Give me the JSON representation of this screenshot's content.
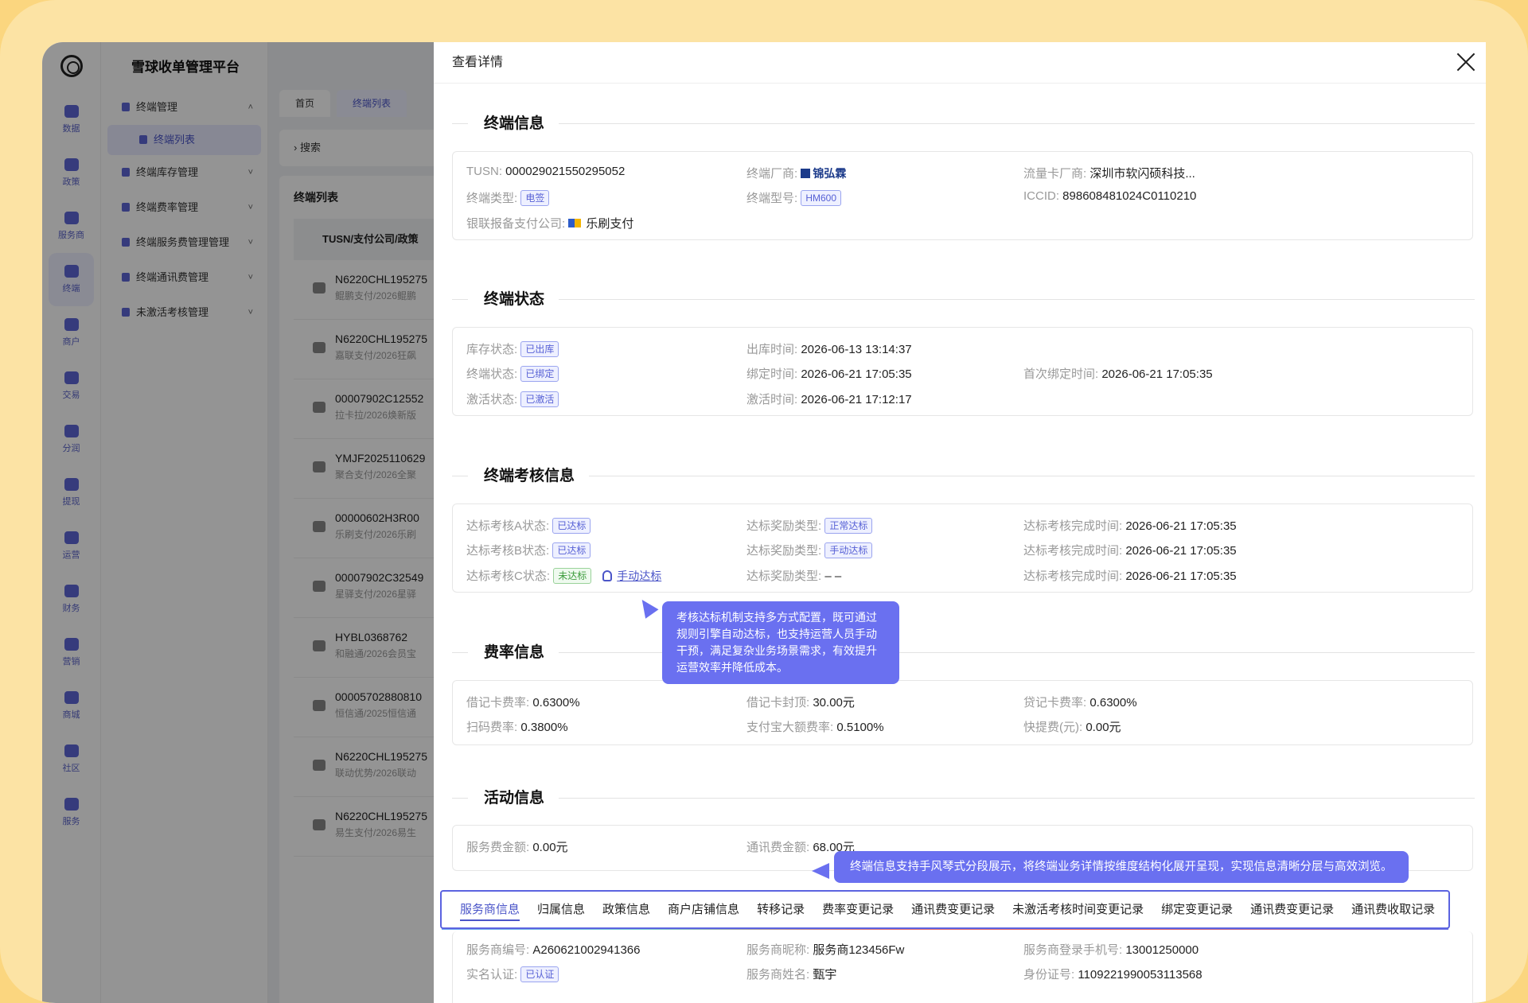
{
  "platform_name": "雪球收单管理平台",
  "rail": [
    {
      "label": "数据",
      "icon": "chart-icon"
    },
    {
      "label": "政策",
      "icon": "grid-icon"
    },
    {
      "label": "服务商",
      "icon": "user-icon"
    },
    {
      "label": "终端",
      "icon": "terminal-icon"
    },
    {
      "label": "商户",
      "icon": "shop-icon"
    },
    {
      "label": "交易",
      "icon": "trade-icon"
    },
    {
      "label": "分润",
      "icon": "split-icon"
    },
    {
      "label": "提现",
      "icon": "withdraw-icon"
    },
    {
      "label": "运营",
      "icon": "monitor-icon"
    },
    {
      "label": "财务",
      "icon": "shield-icon"
    },
    {
      "label": "营销",
      "icon": "gift-icon"
    },
    {
      "label": "商城",
      "icon": "bag-icon"
    },
    {
      "label": "社区",
      "icon": "chat-icon"
    },
    {
      "label": "服务",
      "icon": "service-icon"
    }
  ],
  "menu": {
    "items": [
      {
        "label": "终端管理",
        "chev": "˄"
      },
      {
        "label": "终端列表",
        "sub": true
      },
      {
        "label": "终端库存管理",
        "chev": "˅"
      },
      {
        "label": "终端费率管理",
        "chev": "˅"
      },
      {
        "label": "终端服务费管理管理",
        "chev": "˅"
      },
      {
        "label": "终端通讯费管理",
        "chev": "˅"
      },
      {
        "label": "未激活考核管理",
        "chev": "˅"
      }
    ]
  },
  "page": {
    "tabs": [
      "首页",
      "终端列表"
    ],
    "search": "› 搜索",
    "list_title": "终端列表",
    "list_head": "TUSN/支付公司/政策",
    "rows": [
      {
        "t1": "N6220CHL195275",
        "t2": "鲲鹏支付/2026鲲鹏"
      },
      {
        "t1": "N6220CHL195275",
        "t2": "嘉联支付/2026狂飙"
      },
      {
        "t1": "00007902C12552",
        "t2": "拉卡拉/2026焕新版"
      },
      {
        "t1": "YMJF2025110629",
        "t2": "聚合支付/2026全聚"
      },
      {
        "t1": "00000602H3R00",
        "t2": "乐刷支付/2026乐刷"
      },
      {
        "t1": "00007902C32549",
        "t2": "星驿支付/2026星驿"
      },
      {
        "t1": "HYBL0368762",
        "t2": "和融通/2026会员宝"
      },
      {
        "t1": "00005702880810",
        "t2": "恒信通/2025恒信通"
      },
      {
        "t1": "N6220CHL195275",
        "t2": "联动优势/2026联动"
      },
      {
        "t1": "N6220CHL195275",
        "t2": "易生支付/2026易生"
      }
    ]
  },
  "drawer": {
    "title": "查看详情",
    "sections": {
      "terminal": "终端信息",
      "status": "终端状态",
      "assess": "终端考核信息",
      "rate": "费率信息",
      "activity": "活动信息"
    },
    "terminal": {
      "tusn_label": "TUSN:",
      "tusn": "000029021550295052",
      "vendor_label": "终端厂商:",
      "vendor": "锦弘霖",
      "card_vendor_label": "流量卡厂商:",
      "card_vendor": "深圳市软闪硕科技...",
      "type_label": "终端类型:",
      "type": "电签",
      "model_label": "终端型号:",
      "model": "HM600",
      "iccid_label": "ICCID:",
      "iccid": "898608481024C0110210",
      "union_label": "银联报备支付公司:",
      "union": "乐刷支付"
    },
    "status": {
      "stock_label": "库存状态:",
      "stock": "已出库",
      "out_time_label": "出库时间:",
      "out_time": "2026-06-13 13:14:37",
      "term_label": "终端状态:",
      "term": "已绑定",
      "bind_time_label": "绑定时间:",
      "bind_time": "2026-06-21 17:05:35",
      "first_bind_label": "首次绑定时间:",
      "first_bind": "2026-06-21 17:05:35",
      "act_label": "激活状态:",
      "act": "已激活",
      "act_time_label": "激活时间:",
      "act_time": "2026-06-21 17:12:17"
    },
    "assess": {
      "a_label": "达标考核A状态:",
      "a": "已达标",
      "a_type_label": "达标奖励类型:",
      "a_type": "正常达标",
      "a_time_label": "达标考核完成时间:",
      "a_time": "2026-06-21 17:05:35",
      "b_label": "达标考核B状态:",
      "b": "已达标",
      "b_type_label": "达标奖励类型:",
      "b_type": "手动达标",
      "b_time_label": "达标考核完成时间:",
      "b_time": "2026-06-21 17:05:35",
      "c_label": "达标考核C状态:",
      "c": "未达标",
      "manual_link": "手动达标",
      "c_type_label": "达标奖励类型:",
      "c_type": "– –",
      "c_time_label": "达标考核完成时间:",
      "c_time": "2026-06-21 17:05:35"
    },
    "rate": {
      "debit_label": "借记卡费率:",
      "debit": "0.6300%",
      "debit_cap_label": "借记卡封顶:",
      "debit_cap": "30.00元",
      "credit_label": "贷记卡费率:",
      "credit": "0.6300%",
      "scan_label": "扫码费率:",
      "scan": "0.3800%",
      "alipay_label": "支付宝大额费率:",
      "alipay": "0.5100%",
      "quick_label": "快提费(元):",
      "quick": "0.00元"
    },
    "activity": {
      "service_fee_label": "服务费金额:",
      "service_fee": "0.00元",
      "comm_fee_label": "通讯费金额:",
      "comm_fee": "68.00元"
    },
    "tip1": "考核达标机制支持多方式配置，既可通过规则引擎自动达标，也支持运营人员手动干预，满足复杂业务场景需求，有效提升运营效率并降低成本。",
    "tip2": "终端信息支持手风琴式分段展示，将终端业务详情按维度结构化展开呈现，实现信息清晰分层与高效浏览。",
    "tabs": [
      "服务商信息",
      "归属信息",
      "政策信息",
      "商户店铺信息",
      "转移记录",
      "费率变更记录",
      "通讯费变更记录",
      "未激活考核时间变更记录",
      "绑定变更记录",
      "通讯费变更记录",
      "通讯费收取记录"
    ],
    "agent": {
      "no_label": "服务商编号:",
      "no": "A260621002941366",
      "nick_label": "服务商昵称:",
      "nick": "服务商123456Fw",
      "phone_label": "服务商登录手机号:",
      "phone": "13001250000",
      "auth_label": "实名认证:",
      "auth": "已认证",
      "name_label": "服务商姓名:",
      "name": "甄宇",
      "id_label": "身份证号:",
      "id": "1109221990053113568"
    }
  }
}
